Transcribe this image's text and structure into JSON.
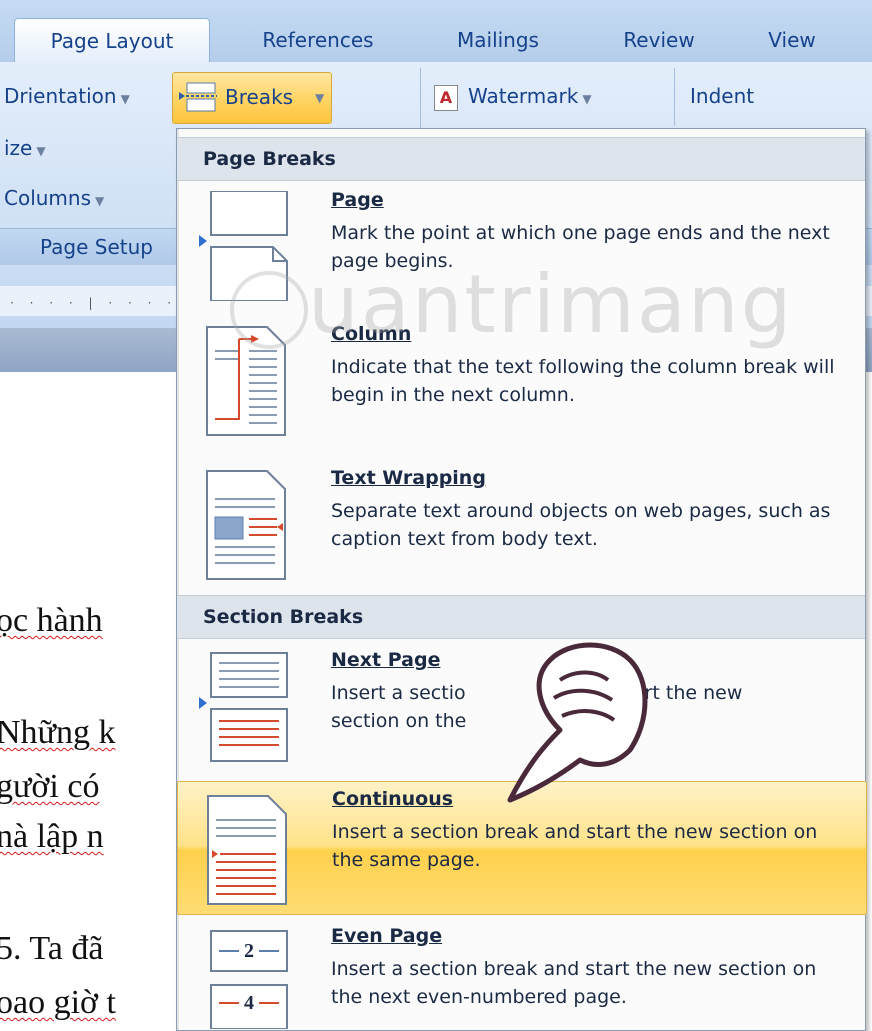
{
  "ribbon": {
    "tabs": [
      {
        "label": "Page Layout"
      },
      {
        "label": "References"
      },
      {
        "label": "Mailings"
      },
      {
        "label": "Review"
      },
      {
        "label": "View"
      }
    ],
    "orientation_label": "Drientation",
    "breaks_label": "Breaks",
    "watermark_label": "Watermark",
    "indent_label": "Indent",
    "size_label": "ize",
    "columns_label": "Columns",
    "group_label": "Page Setup"
  },
  "document": {
    "lines": [
      "ọc hành",
      "Những k",
      "gười có",
      "nà lập n",
      "5. Ta đã",
      "oao giờ t"
    ]
  },
  "menu": {
    "page_breaks_header": "Page Breaks",
    "section_breaks_header": "Section Breaks",
    "items": [
      {
        "title": "Page",
        "desc": "Mark the point at which one page ends and the next page begins."
      },
      {
        "title": "Column",
        "desc": "Indicate that the text following the column break will begin in the next column."
      },
      {
        "title": "Text Wrapping",
        "desc": "Separate text around objects on web pages, such as caption text from body text."
      },
      {
        "title": "Next Page",
        "desc_a": "Insert a sectio",
        "desc_b": "start the new",
        "desc_c": "section on the"
      },
      {
        "title": "Continuous",
        "desc": "Insert a section break and start the new section on the same page."
      },
      {
        "title": "Even Page",
        "desc": "Insert a section break and start the new section on the next even-numbered page."
      }
    ]
  },
  "watermark_text": "uantrimang",
  "icons": {
    "breaks": "page-break-icon",
    "watermark": "watermark-icon",
    "hand": "hand-pointer-icon"
  }
}
